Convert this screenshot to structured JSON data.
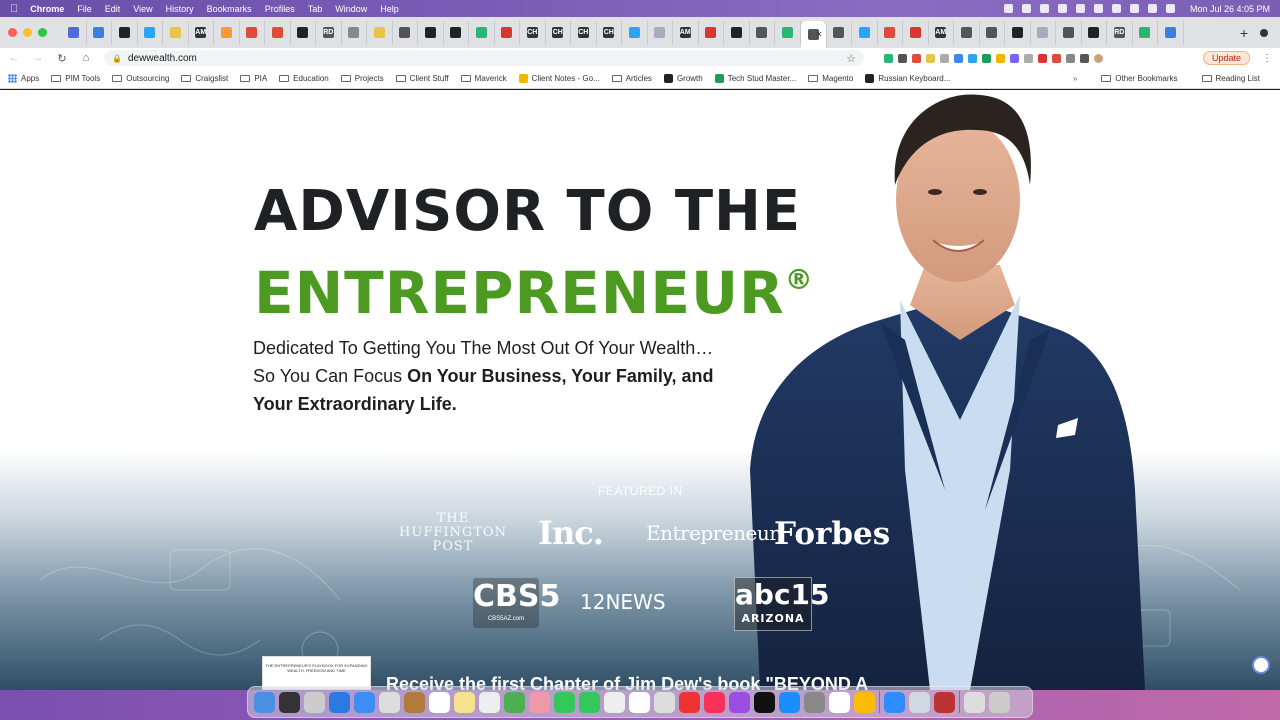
{
  "menubar": {
    "app": "Chrome",
    "items": [
      "File",
      "Edit",
      "View",
      "History",
      "Bookmarks",
      "Profiles",
      "Tab",
      "Window",
      "Help"
    ],
    "clock": "Mon Jul 26  4:05 PM"
  },
  "tabs": [
    {
      "label": "",
      "color": "#4f6bd8"
    },
    {
      "label": "",
      "color": "#3c7de0"
    },
    {
      "label": "",
      "color": "#222"
    },
    {
      "label": "",
      "color": "#2aa4f4"
    },
    {
      "label": "",
      "color": "#e8c44a"
    },
    {
      "label": "AM",
      "color": "#333"
    },
    {
      "label": "",
      "color": "#f29c38"
    },
    {
      "label": "",
      "color": "#e04b3a"
    },
    {
      "label": "",
      "color": "#e04b3a"
    },
    {
      "label": "",
      "color": "#222"
    },
    {
      "label": "RD",
      "color": "#555"
    },
    {
      "label": "",
      "color": "#888"
    },
    {
      "label": "",
      "color": "#e8c44a"
    },
    {
      "label": "",
      "color": "#555"
    },
    {
      "label": "",
      "color": "#222"
    },
    {
      "label": "",
      "color": "#222"
    },
    {
      "label": "",
      "color": "#2bb673"
    },
    {
      "label": "",
      "color": "#d33"
    },
    {
      "label": "CH",
      "color": "#333"
    },
    {
      "label": "CH",
      "color": "#333"
    },
    {
      "label": "CH",
      "color": "#333"
    },
    {
      "label": "CH",
      "color": "#333"
    },
    {
      "label": "",
      "color": "#2aa4f4"
    },
    {
      "label": "",
      "color": "#aab"
    },
    {
      "label": "AM",
      "color": "#333"
    },
    {
      "label": "",
      "color": "#d33"
    },
    {
      "label": "",
      "color": "#222"
    },
    {
      "label": "",
      "color": "#555"
    },
    {
      "label": "",
      "color": "#2bb673"
    },
    {
      "label": "",
      "color": "#555",
      "active": true
    },
    {
      "label": "",
      "color": "#555"
    },
    {
      "label": "",
      "color": "#2aa4f4"
    },
    {
      "label": "",
      "color": "#e04b3a"
    },
    {
      "label": "",
      "color": "#d33"
    },
    {
      "label": "AM",
      "color": "#333"
    },
    {
      "label": "",
      "color": "#555"
    },
    {
      "label": "",
      "color": "#555"
    },
    {
      "label": "",
      "color": "#222"
    },
    {
      "label": "",
      "color": "#aab"
    },
    {
      "label": "",
      "color": "#555"
    },
    {
      "label": "",
      "color": "#222"
    },
    {
      "label": "RD",
      "color": "#555"
    },
    {
      "label": "",
      "color": "#2bb673"
    },
    {
      "label": "",
      "color": "#3c7de0"
    }
  ],
  "toolbar": {
    "url": "dewwealth.com",
    "update_label": "Update"
  },
  "bookmarks": {
    "apps": "Apps",
    "items": [
      "PIM Tools",
      "Outsourcing",
      "Craigslist",
      "PIA",
      "Education",
      "Projects",
      "Client Stuff",
      "Maverick",
      "Client Notes - Go...",
      "Articles",
      "Growth",
      "Tech Stud Master...",
      "Magento",
      "Russian Keyboard..."
    ],
    "other": "Other Bookmarks",
    "reading": "Reading List"
  },
  "hero": {
    "line1": "ADVISOR TO THE",
    "line2": "ENTREPRENEUR",
    "reg": "®",
    "sub1": "Dedicated To Getting You The Most Out Of Your Wealth…",
    "sub2_plain": "So You Can Focus ",
    "sub2_bold": "On Your Business, Your Family, and",
    "sub3_bold": "Your Extraordinary Life."
  },
  "featured": {
    "heading": "FEATURED IN",
    "huffington": [
      "THE",
      "HUFFINGTON",
      "POST"
    ],
    "inc": "Inc.",
    "entrepreneur": "Entrepreneur",
    "forbes": "Forbes",
    "cbs_big": "CBS5",
    "cbs_small": "CBS5AZ.com",
    "news": "12NEWS",
    "abc_big": "abc15",
    "abc_small": "ARIZONA"
  },
  "promo": {
    "book_text": "THE ENTREPRENEUR'S PLAYBOOK FOR EXPANDING WEALTH, FREEDOM AND TIME",
    "text": "Receive the first Chapter of Jim Dew's book \"BEYOND A"
  }
}
